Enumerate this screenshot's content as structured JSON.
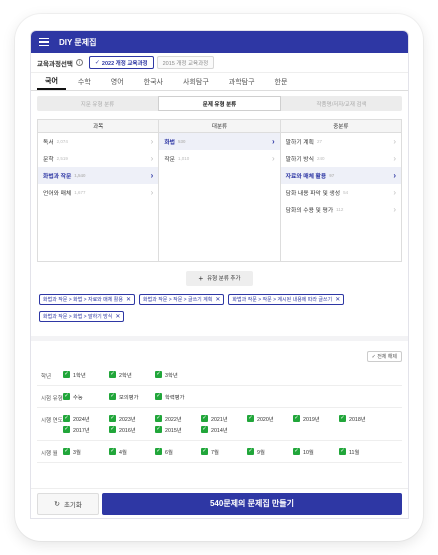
{
  "app": {
    "title": "DIY 문제집"
  },
  "curriculum": {
    "label": "교육과정선택",
    "info_icon": "i",
    "options": [
      {
        "label": "2022 개정 교육과정",
        "selected": true
      },
      {
        "label": "2015 개정 교육과정",
        "selected": false
      }
    ]
  },
  "subjects": [
    {
      "label": "국어",
      "active": true
    },
    {
      "label": "수학"
    },
    {
      "label": "영어"
    },
    {
      "label": "한국사"
    },
    {
      "label": "사회탐구"
    },
    {
      "label": "과학탐구"
    },
    {
      "label": "한문"
    }
  ],
  "subtabs": [
    {
      "label": "지문 유형 분류"
    },
    {
      "label": "문제 유형 분류",
      "active": true
    },
    {
      "label": "작품명/저자/교재 검색"
    }
  ],
  "columns": [
    {
      "header": "과목",
      "items": [
        {
          "label": "독서",
          "count": "2,074"
        },
        {
          "label": "문학",
          "count": "2,519"
        },
        {
          "label": "화법과 작문",
          "count": "1,540",
          "selected": true
        },
        {
          "label": "언어와 매체",
          "count": "1,677"
        }
      ]
    },
    {
      "header": "대분류",
      "items": [
        {
          "label": "화법",
          "count": "530",
          "selected": true
        },
        {
          "label": "작문",
          "count": "1,010"
        }
      ]
    },
    {
      "header": "중분류",
      "items": [
        {
          "label": "말하기 계획",
          "count": "27"
        },
        {
          "label": "말하기 방식",
          "count": "240"
        },
        {
          "label": "자료와 매체 활용",
          "count": "97",
          "selected": true
        },
        {
          "label": "담화 내용 파악 및 생성",
          "count": "54"
        },
        {
          "label": "담화의 수용 및 평가",
          "count": "112"
        }
      ]
    }
  ],
  "add_button": "유형 분류 추가",
  "chips": [
    "화법과 작문 > 화법 > 자료와 매체 활용",
    "화법과 작문 > 작문 > 글쓰기 계획",
    "화법과 작문 > 작문 > 계시된 내용에 따라 글쓰기",
    "화법과 작문 > 화법 > 말하기 방식"
  ],
  "reset_all": "전체 해제",
  "filters": [
    {
      "label": "학년",
      "options": [
        "1학년",
        "2학년",
        "3학년"
      ]
    },
    {
      "label": "시험 유형",
      "options": [
        "수능",
        "모의평가",
        "학력평가"
      ]
    },
    {
      "label": "시행 연도",
      "options": [
        "2024년",
        "2023년",
        "2022년",
        "2021년",
        "2020년",
        "2019년",
        "2018년",
        "2017년",
        "2016년",
        "2015년",
        "2014년"
      ],
      "wide": true
    },
    {
      "label": "시행 월",
      "options": [
        "3월",
        "4월",
        "6월",
        "7월",
        "9월",
        "10월",
        "11월"
      ],
      "wide": true
    }
  ],
  "footer": {
    "reset_label": "초기화",
    "make_label": "540문제의 문제집 만들기"
  },
  "colors": {
    "primary": "#2e37a4",
    "check": "#21a63a"
  }
}
